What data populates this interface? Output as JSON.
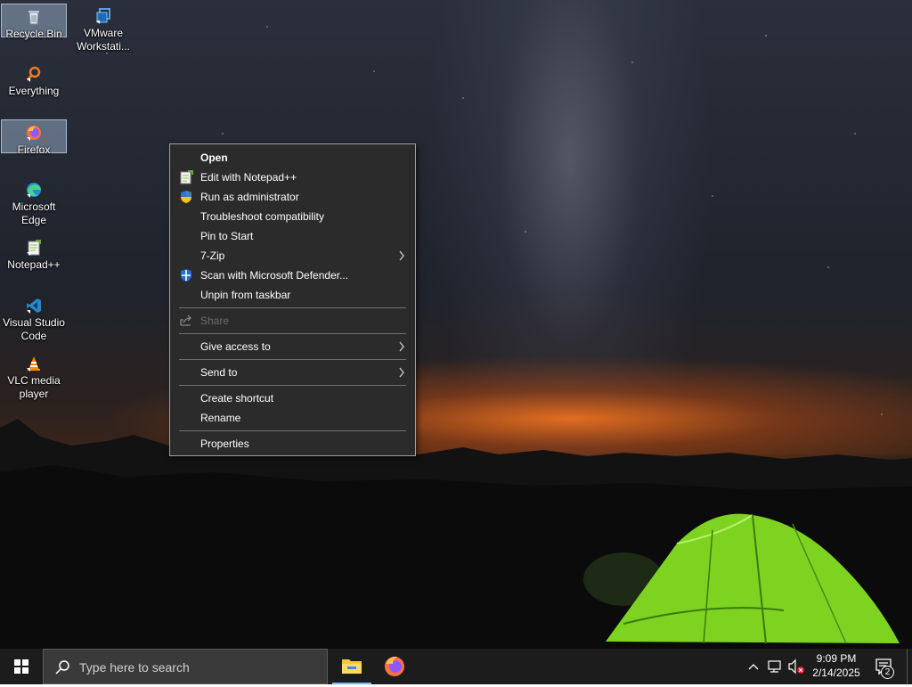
{
  "desktop": {
    "icons": [
      {
        "label": "Recycle Bin",
        "icon": "recycle-bin-icon",
        "selected": true
      },
      {
        "label": "VMware Workstati...",
        "icon": "vmware-icon",
        "selected": false
      },
      {
        "label": "Everything",
        "icon": "everything-search-icon",
        "selected": false
      },
      {
        "label": "Firefox",
        "icon": "firefox-icon",
        "selected": true
      },
      {
        "label": "Microsoft Edge",
        "icon": "edge-icon",
        "selected": false
      },
      {
        "label": "Notepad++",
        "icon": "notepadpp-icon",
        "selected": false
      },
      {
        "label": "Visual Studio Code",
        "icon": "vscode-icon",
        "selected": false
      },
      {
        "label": "VLC media player",
        "icon": "vlc-icon",
        "selected": false
      }
    ]
  },
  "context_menu": {
    "items": [
      {
        "label": "Open"
      },
      {
        "label": "Edit with Notepad++",
        "icon": "notepadpp-icon"
      },
      {
        "label": "Run as administrator",
        "icon": "uac-shield-icon"
      },
      {
        "label": "Troubleshoot compatibility"
      },
      {
        "label": "Pin to Start"
      },
      {
        "label": "7-Zip",
        "submenu": true
      },
      {
        "label": "Scan with Microsoft Defender...",
        "icon": "defender-shield-icon"
      },
      {
        "label": "Unpin from taskbar"
      },
      {
        "label": "Share",
        "icon": "share-icon",
        "disabled": true
      },
      {
        "label": "Give access to",
        "submenu": true
      },
      {
        "label": "Send to",
        "submenu": true
      },
      {
        "label": "Create shortcut"
      },
      {
        "label": "Rename"
      },
      {
        "label": "Properties"
      }
    ]
  },
  "taskbar": {
    "search_placeholder": "Type here to search",
    "apps": [
      {
        "name": "File Explorer",
        "icon": "file-explorer-icon",
        "active": true
      },
      {
        "name": "Firefox",
        "icon": "firefox-icon",
        "active": false
      }
    ],
    "tray": {
      "icons": [
        "chevron-up-icon",
        "network-icon",
        "volume-muted-icon"
      ],
      "time": "9:09 PM",
      "date": "2/14/2025",
      "notifications_count": "2"
    }
  },
  "colors": {
    "menu_bg": "#2b2b2b",
    "menu_border": "#a0a0a0",
    "taskbar_bg": "#1c1c1c",
    "active_indicator": "#7cb7ea",
    "tent_green": "#7ed321"
  }
}
